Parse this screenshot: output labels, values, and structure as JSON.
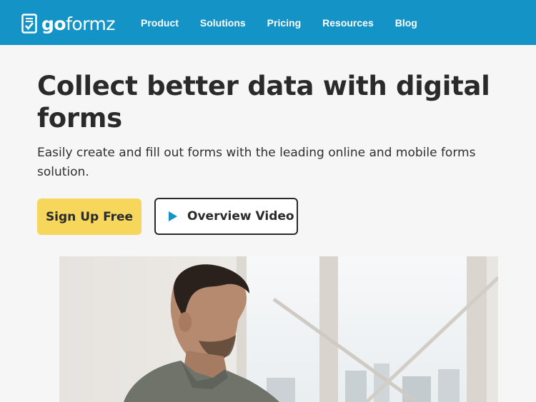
{
  "header": {
    "logo_text_bold": "go",
    "logo_text_light": "formz",
    "nav": [
      {
        "label": "Product"
      },
      {
        "label": "Solutions"
      },
      {
        "label": "Pricing"
      },
      {
        "label": "Resources"
      },
      {
        "label": "Blog"
      }
    ]
  },
  "hero": {
    "title": "Collect better data with digital forms",
    "subtitle": "Easily create and fill out forms with the leading online and mobile forms solution.",
    "primary_cta": "Sign Up Free",
    "secondary_cta": "Overview Video"
  },
  "icons": {
    "logo": "form-checkbox-icon",
    "video": "play-icon"
  },
  "colors": {
    "header_bg": "#1494c6",
    "primary_button": "#f7d65c",
    "play_icon": "#1494c6",
    "text": "#2a2a2a",
    "page_bg": "#f6f6f6"
  }
}
